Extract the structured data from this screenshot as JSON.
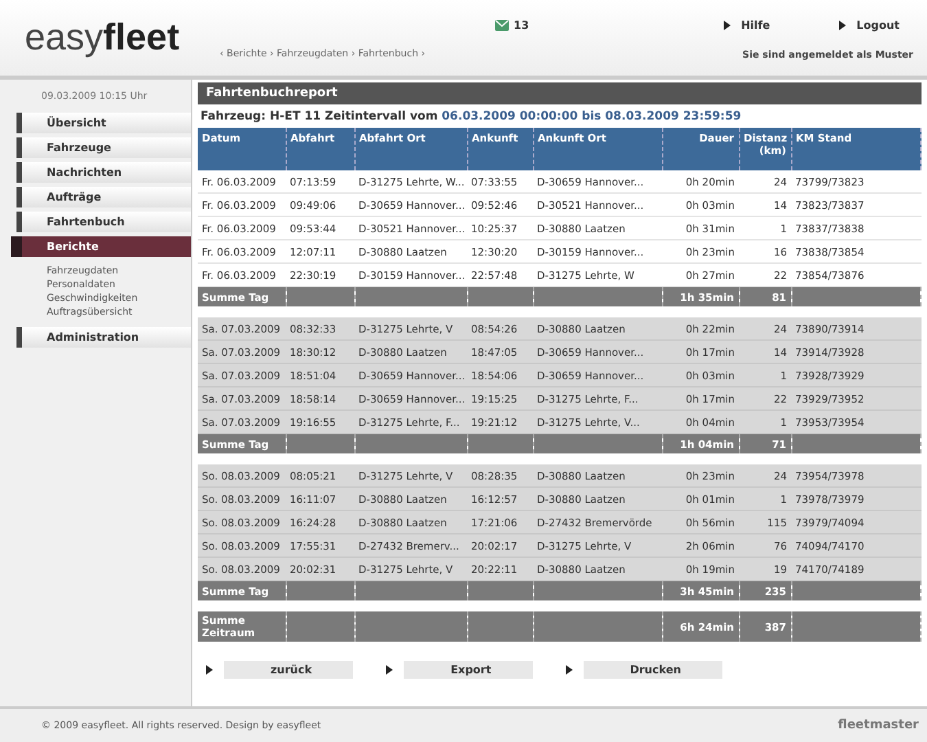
{
  "header": {
    "logo_light": "easy",
    "logo_bold": "fleet",
    "breadcrumb": "‹ Berichte › Fahrzeugdaten › Fahrtenbuch ›",
    "messages": "13",
    "links": [
      "Hilfe",
      "Logout"
    ],
    "user": "Sie sind angemeldet als Muster"
  },
  "sidebar": {
    "date": "09.03.2009 10:15 Uhr",
    "items": [
      {
        "label": "Übersicht",
        "selected": false
      },
      {
        "label": "Fahrzeuge",
        "selected": false
      },
      {
        "label": "Nachrichten",
        "selected": false
      },
      {
        "label": "Aufträge",
        "selected": false
      },
      {
        "label": "Fahrtenbuch",
        "selected": false
      },
      {
        "label": "Berichte",
        "selected": true,
        "children": [
          "Fahrzeugdaten",
          "Personaldaten",
          "Geschwindigkeiten",
          "Auftragsübersicht"
        ]
      },
      {
        "label": "Administration",
        "selected": false
      }
    ]
  },
  "panel": {
    "title": "Fahrtenbuchreport",
    "subtitle_plain": "Fahrzeug: H-ET 11 Zeitintervall vom",
    "subtitle_bold": "06.03.2009 00:00:00 bis 08.03.2009 23:59:59"
  },
  "table": {
    "columns": [
      "Datum",
      "Abfahrt",
      "Abfahrt Ort",
      "Ankunft",
      "Ankunft Ort",
      "Dauer",
      "Distanz (km)",
      "KM Stand"
    ],
    "groups": [
      {
        "shaded": false,
        "rows": [
          [
            "Fr. 06.03.2009",
            "07:13:59",
            "D-31275 Lehrte, W...",
            "07:33:55",
            "D-30659 Hannover...",
            "0h 20min",
            "24",
            "73799/73823"
          ],
          [
            "Fr. 06.03.2009",
            "09:49:06",
            "D-30659 Hannover...",
            "09:52:46",
            "D-30521 Hannover...",
            "0h 03min",
            "14",
            "73823/73837"
          ],
          [
            "Fr. 06.03.2009",
            "09:53:44",
            "D-30521 Hannover...",
            "10:25:37",
            "D-30880 Laatzen",
            "0h 31min",
            "1",
            "73837/73838"
          ],
          [
            "Fr. 06.03.2009",
            "12:07:11",
            "D-30880 Laatzen",
            "12:30:20",
            "D-30159 Hannover...",
            "0h 23min",
            "16",
            "73838/73854"
          ],
          [
            "Fr. 06.03.2009",
            "22:30:19",
            "D-30159 Hannover...",
            "22:57:48",
            "D-31275 Lehrte, W",
            "0h 27min",
            "22",
            "73854/73876"
          ]
        ],
        "sum_label": "Summe Tag",
        "sum_duration": "1h 35min",
        "sum_distance": "81"
      },
      {
        "shaded": true,
        "rows": [
          [
            "Sa. 07.03.2009",
            "08:32:33",
            "D-31275 Lehrte, V",
            "08:54:26",
            "D-30880 Laatzen",
            "0h 22min",
            "24",
            "73890/73914"
          ],
          [
            "Sa. 07.03.2009",
            "18:30:12",
            "D-30880 Laatzen",
            "18:47:05",
            "D-30659 Hannover...",
            "0h 17min",
            "14",
            "73914/73928"
          ],
          [
            "Sa. 07.03.2009",
            "18:51:04",
            "D-30659 Hannover...",
            "18:54:06",
            "D-30659 Hannover...",
            "0h 03min",
            "1",
            "73928/73929"
          ],
          [
            "Sa. 07.03.2009",
            "18:58:14",
            "D-30659 Hannover...",
            "19:15:25",
            "D-31275 Lehrte, F...",
            "0h 17min",
            "22",
            "73929/73952"
          ],
          [
            "Sa. 07.03.2009",
            "19:16:55",
            "D-31275 Lehrte, F...",
            "19:21:12",
            "D-31275 Lehrte, V...",
            "0h 04min",
            "1",
            "73953/73954"
          ]
        ],
        "sum_label": "Summe Tag",
        "sum_duration": "1h 04min",
        "sum_distance": "71"
      },
      {
        "shaded": true,
        "rows": [
          [
            "So. 08.03.2009",
            "08:05:21",
            "D-31275 Lehrte, V",
            "08:28:35",
            "D-30880 Laatzen",
            "0h 23min",
            "24",
            "73954/73978"
          ],
          [
            "So. 08.03.2009",
            "16:11:07",
            "D-30880 Laatzen",
            "16:12:57",
            "D-30880 Laatzen",
            "0h 01min",
            "1",
            "73978/73979"
          ],
          [
            "So. 08.03.2009",
            "16:24:28",
            "D-30880 Laatzen",
            "17:21:06",
            "D-27432 Bremervörde",
            "0h 56min",
            "115",
            "73979/74094"
          ],
          [
            "So. 08.03.2009",
            "17:55:31",
            "D-27432 Bremerv...",
            "20:02:17",
            "D-31275 Lehrte, V",
            "2h 06min",
            "76",
            "74094/74170"
          ],
          [
            "So. 08.03.2009",
            "20:02:31",
            "D-31275 Lehrte, V",
            "20:22:11",
            "D-30880 Laatzen",
            "0h 19min",
            "19",
            "74170/74189"
          ]
        ],
        "sum_label": "Summe Tag",
        "sum_duration": "3h 45min",
        "sum_distance": "235"
      }
    ],
    "total_label": "Summe Zeitraum",
    "total_duration": "6h 24min",
    "total_distance": "387"
  },
  "actions": [
    "zurück",
    "Export",
    "Drucken"
  ],
  "footer": {
    "copyright": "© 2009 easyfleet. All rights reserved. Design by easyfleet",
    "brand": "fleetmaster"
  }
}
